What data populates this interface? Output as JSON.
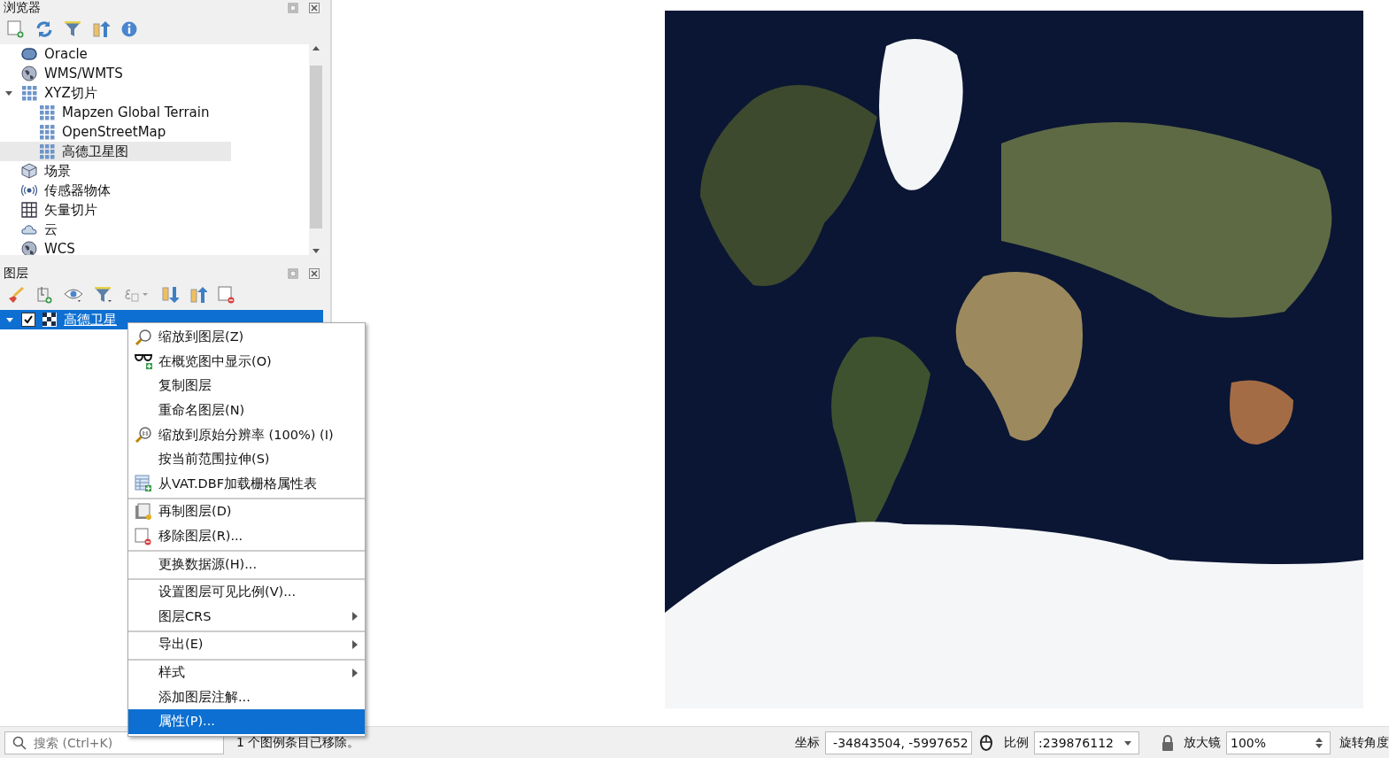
{
  "browser_panel": {
    "title": "浏览器",
    "tree": [
      {
        "label": "Oracle",
        "kind": "database",
        "selected": false
      },
      {
        "label": "WMS/WMTS",
        "kind": "globe",
        "selected": false
      },
      {
        "label": "XYZ切片",
        "kind": "tiles",
        "selected": false,
        "expanded": true,
        "children": [
          {
            "label": "Mapzen Global Terrain",
            "kind": "tiles",
            "selected": false
          },
          {
            "label": "OpenStreetMap",
            "kind": "tiles",
            "selected": false
          },
          {
            "label": "高德卫星图",
            "kind": "tiles",
            "selected": true
          }
        ]
      },
      {
        "label": "场景",
        "kind": "cube",
        "selected": false
      },
      {
        "label": "传感器物体",
        "kind": "sensor",
        "selected": false
      },
      {
        "label": "矢量切片",
        "kind": "grid",
        "selected": false
      },
      {
        "label": "云",
        "kind": "cloud",
        "selected": false
      },
      {
        "label": "WCS",
        "kind": "globe",
        "selected": false
      }
    ]
  },
  "layers_panel": {
    "title": "图层",
    "layers": [
      {
        "name": "高德卫星",
        "expanded": true,
        "checked": true,
        "selected": true
      }
    ]
  },
  "context_menu": [
    {
      "label": "缩放到图层(Z)",
      "kind": "zoom",
      "separator_before": false,
      "submenu": false,
      "selected": false
    },
    {
      "label": "在概览图中显示(O)",
      "kind": "overview",
      "separator_before": false,
      "submenu": false,
      "selected": false
    },
    {
      "label": "复制图层",
      "kind": "plain",
      "separator_before": false,
      "submenu": false,
      "selected": false
    },
    {
      "label": "重命名图层(N)",
      "kind": "plain",
      "separator_before": false,
      "submenu": false,
      "selected": false
    },
    {
      "label": "缩放到原始分辨率 (100%) (I)",
      "kind": "zoom-native",
      "separator_before": false,
      "submenu": false,
      "selected": false
    },
    {
      "label": "按当前范围拉伸(S)",
      "kind": "plain",
      "separator_before": false,
      "submenu": false,
      "selected": false
    },
    {
      "label": "从VAT.DBF加载栅格属性表",
      "kind": "table",
      "separator_before": false,
      "submenu": false,
      "selected": false
    },
    {
      "label": "再制图层(D)",
      "kind": "duplicate",
      "separator_before": true,
      "submenu": false,
      "selected": false
    },
    {
      "label": "移除图层(R)...",
      "kind": "remove",
      "separator_before": false,
      "submenu": false,
      "selected": false
    },
    {
      "label": "更换数据源(H)...",
      "kind": "plain",
      "separator_before": true,
      "submenu": false,
      "selected": false
    },
    {
      "label": "设置图层可见比例(V)...",
      "kind": "plain",
      "separator_before": true,
      "submenu": false,
      "selected": false
    },
    {
      "label": "图层CRS",
      "kind": "plain",
      "separator_before": false,
      "submenu": true,
      "selected": false
    },
    {
      "label": "导出(E)",
      "kind": "plain",
      "separator_before": true,
      "submenu": true,
      "selected": false
    },
    {
      "label": "样式",
      "kind": "plain",
      "separator_before": true,
      "submenu": true,
      "selected": false
    },
    {
      "label": "添加图层注解...",
      "kind": "plain",
      "separator_before": false,
      "submenu": false,
      "selected": false
    },
    {
      "label": "属性(P)...",
      "kind": "plain",
      "separator_before": false,
      "submenu": false,
      "selected": true
    }
  ],
  "status_bar": {
    "search": {
      "placeholder": "搜索 (Ctrl+K)"
    },
    "message": "1 个图例条目已移除。",
    "coordinate": {
      "label": "坐标",
      "value": "-34843504, -5997652"
    },
    "scale": {
      "label": "比例",
      "value": ":239876112"
    },
    "magnifier": {
      "label": "放大镜",
      "value": "100%"
    },
    "rotation": {
      "label": "旋转角度"
    }
  }
}
